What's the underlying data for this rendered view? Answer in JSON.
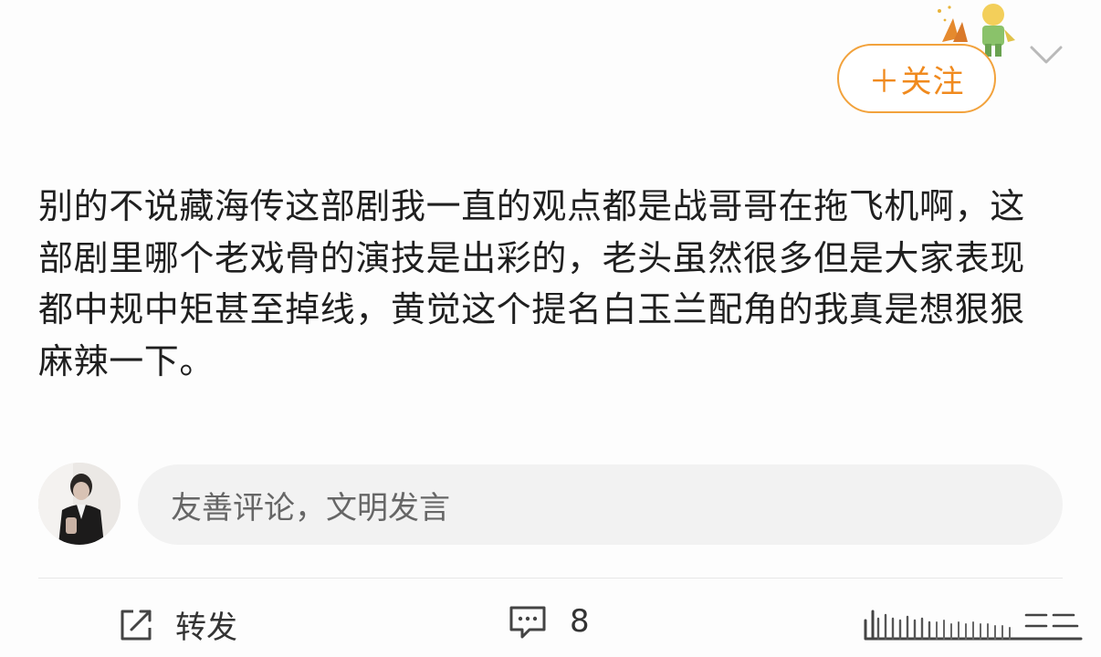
{
  "header": {
    "follow_label": "＋关注",
    "sticker_icon": "little-prince-sticker-icon",
    "menu_icon": "chevron-down-icon"
  },
  "post": {
    "text": "别的不说藏海传这部剧我一直的观点都是战哥哥在拖飞机啊，这部剧里哪个老戏骨的演技是出彩的，老头虽然很多但是大家表现都中规中矩甚至掉线，黄觉这个提名白玉兰配角的我真是想狠狠麻辣一下。"
  },
  "comment_box": {
    "placeholder": "友善评论，文明发言",
    "avatar_icon": "user-avatar"
  },
  "actions": {
    "repost_label": "转发",
    "repost_icon": "share-icon",
    "comment_count": "8",
    "comment_icon": "comment-icon",
    "like_icon": "thumbs-up-icon"
  },
  "colors": {
    "accent": "#f08a1e",
    "accent_border": "#f2a23c",
    "text": "#1f1f1f",
    "placeholder": "#666666",
    "input_bg": "#f2f2f2"
  }
}
